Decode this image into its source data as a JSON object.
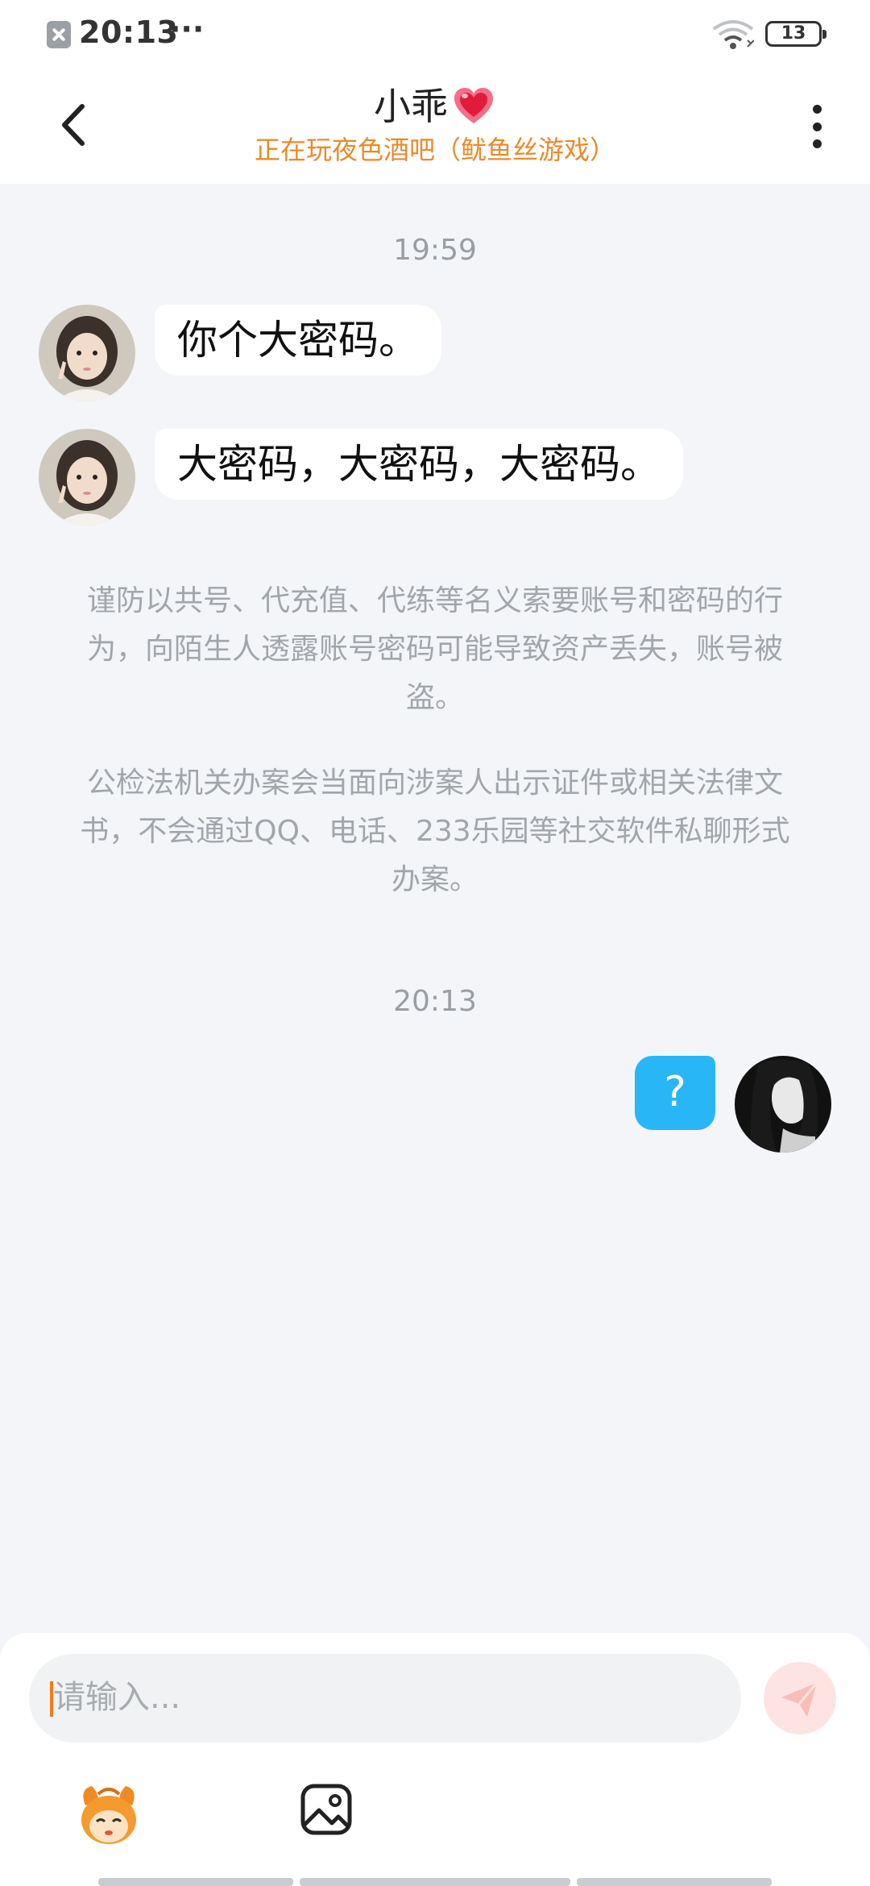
{
  "status_bar": {
    "time": "20:13",
    "more": "···",
    "battery": "13"
  },
  "header": {
    "title": "小乖",
    "subtitle": "正在玩夜色酒吧（鱿鱼丝游戏）"
  },
  "messages": [
    {
      "type": "time",
      "text": "19:59"
    },
    {
      "type": "received",
      "text": "你个大密码。"
    },
    {
      "type": "received",
      "text": "大密码，大密码，大密码。"
    },
    {
      "type": "notice",
      "text": "谨防以共号、代充值、代练等名义索要账号和密码的行为，向陌生人透露账号密码可能导致资产丢失，账号被盗。"
    },
    {
      "type": "notice",
      "text": "公检法机关办案会当面向涉案人出示证件或相关法律文书，不会通过QQ、电话、233乐园等社交软件私聊形式办案。"
    },
    {
      "type": "time",
      "text": "20:13"
    },
    {
      "type": "sent",
      "text": "?"
    }
  ],
  "input": {
    "placeholder": "请输入..."
  },
  "icons": {
    "back": "chevron-left-icon",
    "more": "more-vertical-icon",
    "send": "send-icon",
    "emoji": "mascot-icon",
    "image": "image-icon"
  },
  "colors": {
    "accent_orange": "#e98a2c",
    "sent_bubble": "#29b6f6",
    "background": "#f3f5f8",
    "send_button": "#fde4e2"
  }
}
